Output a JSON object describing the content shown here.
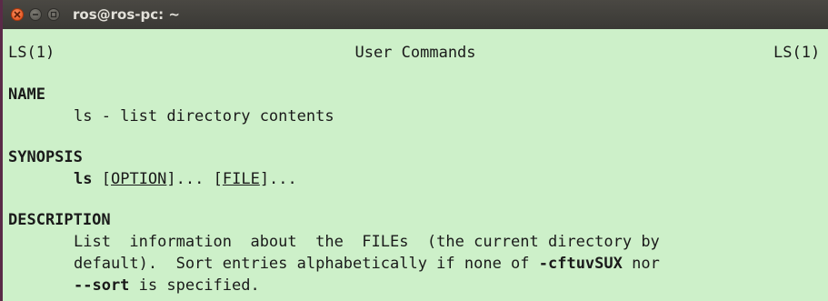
{
  "window": {
    "title": "ros@ros-pc: ~",
    "buttons": [
      "close-icon",
      "minimize-icon",
      "maximize-icon"
    ]
  },
  "colors": {
    "terminal_background": "#cdf0c9",
    "titlebar": "#3e3d39",
    "close_button": "#e95420",
    "left_border": "#5a2a48"
  },
  "man": {
    "header_left": "LS(1)",
    "header_center": "User Commands",
    "header_right": "LS(1)",
    "name_heading": "NAME",
    "name_line": "ls - list directory contents",
    "synopsis_heading": "SYNOPSIS",
    "synopsis": {
      "cmd": "ls",
      "open1": "[",
      "option": "OPTION",
      "close1": "]...",
      "sep": " ",
      "open2": "[",
      "file": "FILE",
      "close2": "]..."
    },
    "description_heading": "DESCRIPTION",
    "description": {
      "line1": "List  information  about  the  FILEs  (the current directory by",
      "line2_pre": "default).  Sort entries alphabetically if none of ",
      "line2_bold": "-cftuvSUX",
      "line2_post": " nor",
      "line3_bold": "--sort",
      "line3_post": " is specified."
    }
  }
}
